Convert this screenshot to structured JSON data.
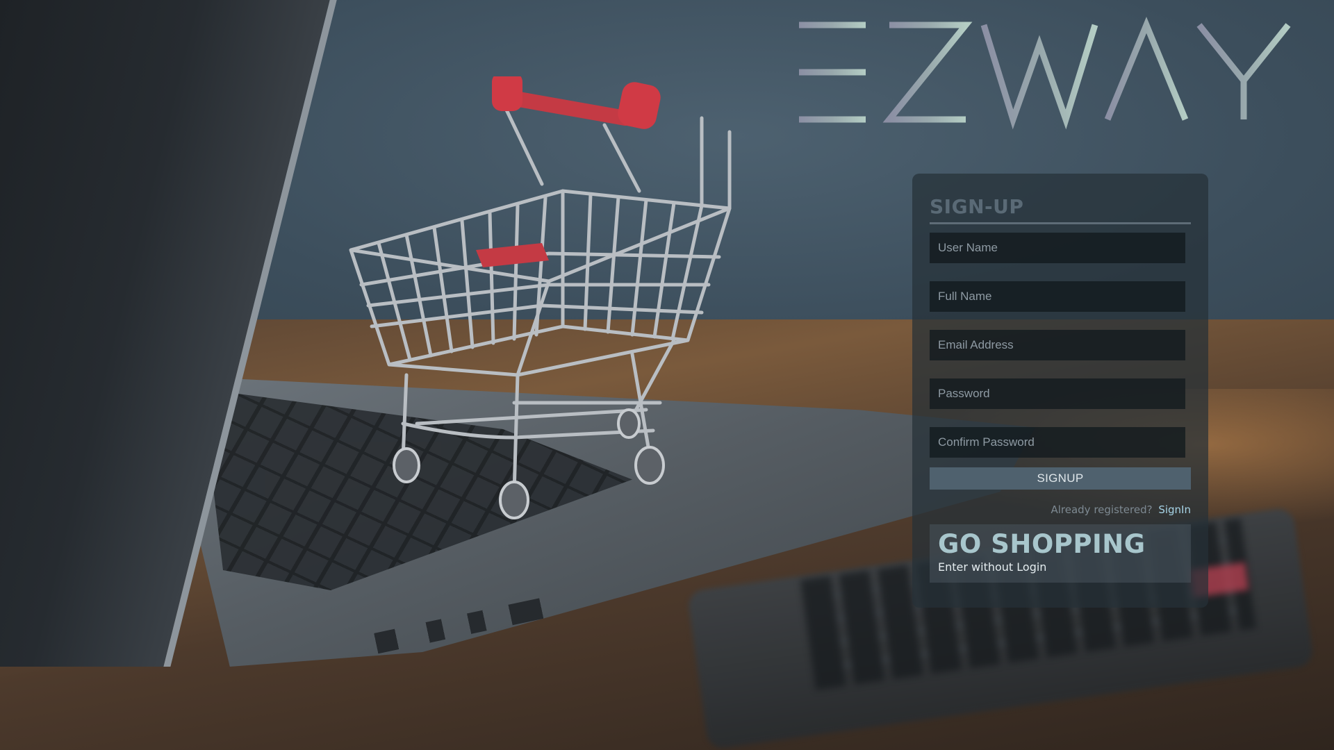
{
  "logo": {
    "text": "EZWAY"
  },
  "signup": {
    "title": "SIGN-UP",
    "fields": {
      "username": {
        "placeholder": "User Name",
        "value": ""
      },
      "fullname": {
        "placeholder": "Full Name",
        "value": ""
      },
      "email": {
        "placeholder": "Email Address",
        "value": ""
      },
      "password": {
        "placeholder": "Password",
        "value": ""
      },
      "confirm_password": {
        "placeholder": "Confirm Password",
        "value": ""
      }
    },
    "button_label": "SIGNUP",
    "already_text": "Already registered?",
    "signin_link": "SignIn"
  },
  "go_shopping": {
    "title": "GO SHOPPING",
    "subtitle": "Enter without Login"
  },
  "colors": {
    "logo": "#a8b4ba",
    "panel_title": "#5a6a76",
    "accent_link": "#a6d3e6",
    "go_title": "#a8c6cc",
    "cart_red": "#d03a45"
  },
  "icons": {
    "cart": "shopping-cart-icon"
  }
}
